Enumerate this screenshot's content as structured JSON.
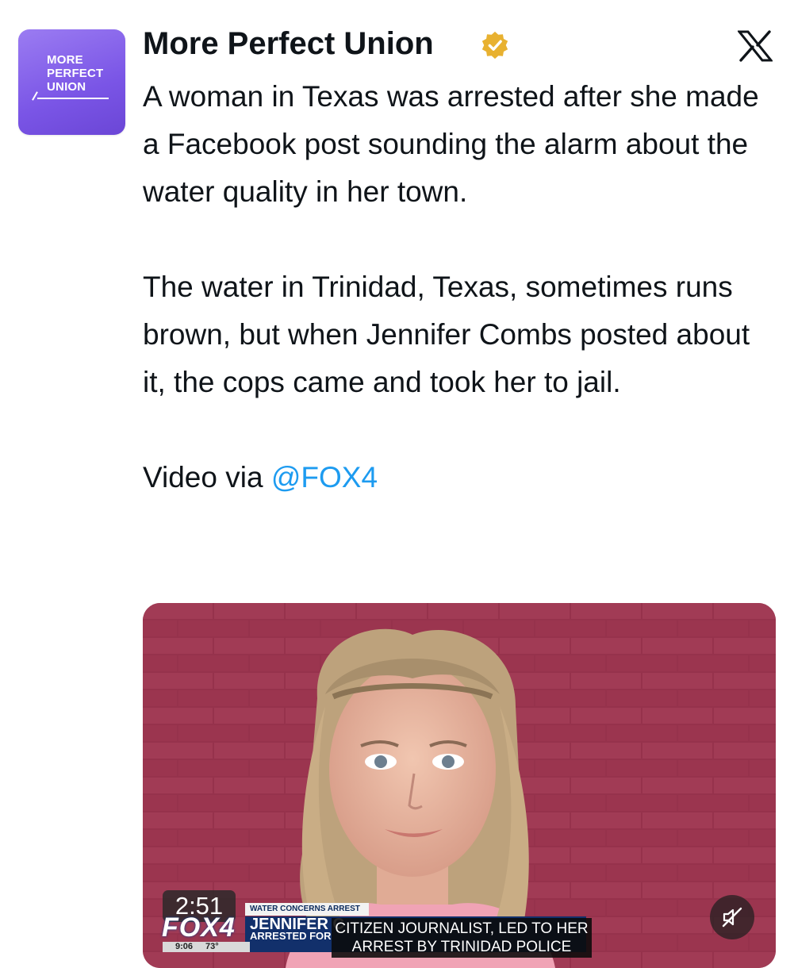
{
  "account": {
    "avatar_text": [
      "MORE",
      "PERFECT",
      "UNION"
    ],
    "display_name": "More Perfect Union"
  },
  "icons": {
    "verified": "verified-badge-icon",
    "platform": "x-logo-icon",
    "mute": "volume-muted-icon"
  },
  "colors": {
    "accent": "#1d9bf0",
    "verified_gold": "#e8b130",
    "avatar_purple": "#7a55e6",
    "broadcast_blue": "#12306b"
  },
  "tweet": {
    "paragraphs": [
      "A woman in Texas was arrested after she made a Facebook post sounding the alarm about the water quality in her town.",
      "The water in Trinidad, Texas, sometimes runs brown, but when Jennifer Combs posted about it, the cops came and took her to jail."
    ],
    "video_via_prefix": "Video via ",
    "mention": "@FOX4"
  },
  "video": {
    "duration": "2:51",
    "broadcast": {
      "station_logo": "FOX4",
      "topic": "WATER CONCERNS ARREST",
      "name": "JENNIFER C",
      "subline": "ARRESTED FOR",
      "caption": "CITIZEN JOURNALIST, LED TO HER ARREST BY TRINIDAD POLICE",
      "time": "9:06",
      "temperature": "73°"
    }
  }
}
